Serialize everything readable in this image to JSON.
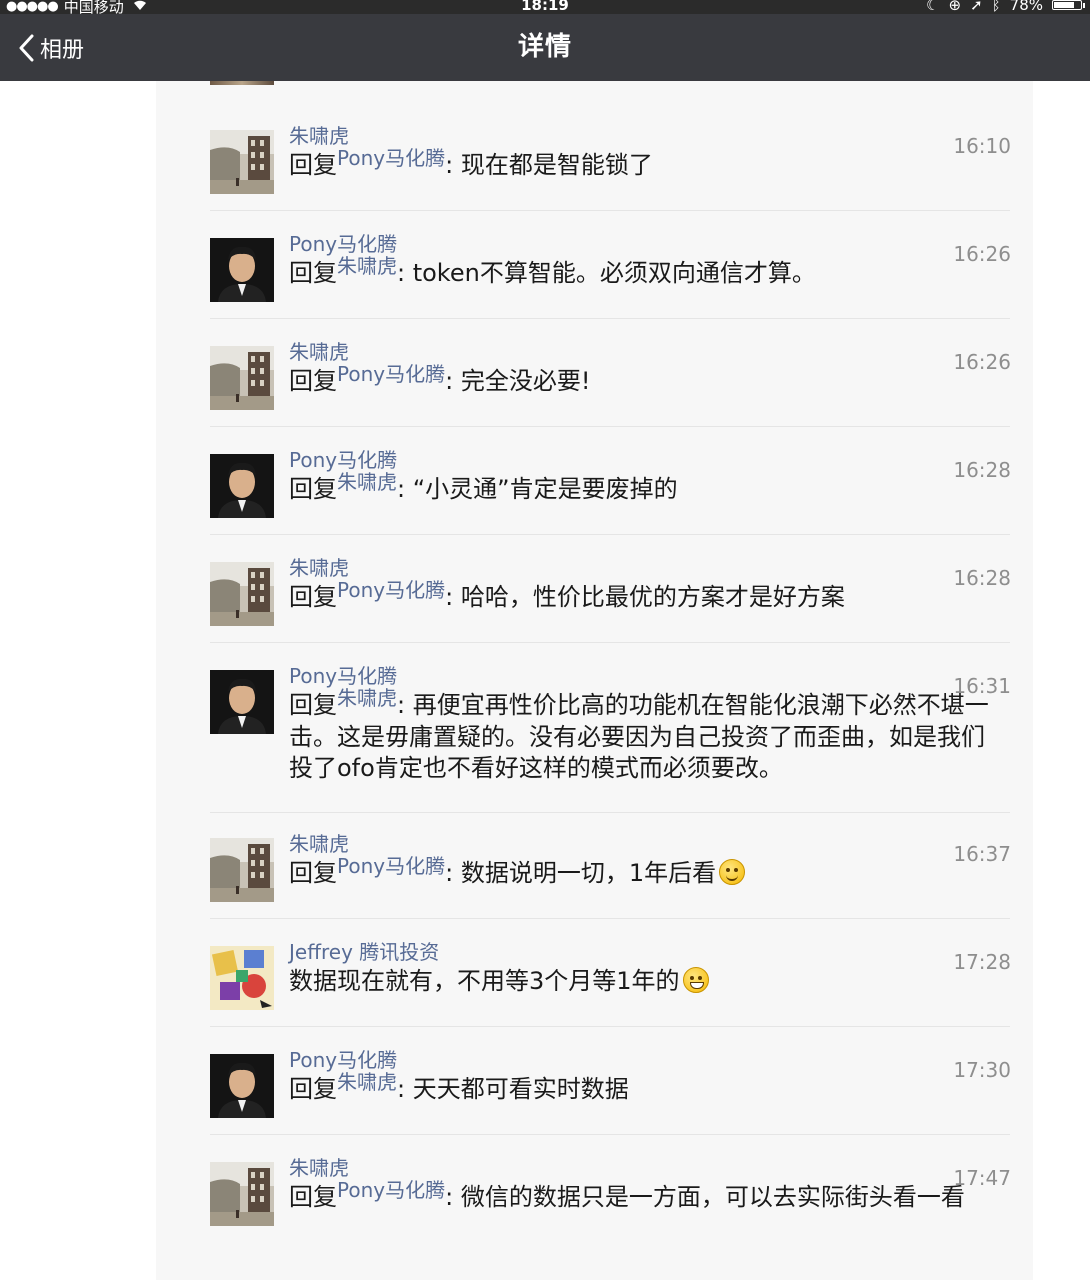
{
  "status_bar": {
    "signal": "●●●●●",
    "carrier": "中国移动",
    "wifi_icon": "wifi-icon",
    "time": "18:19",
    "battery": "78%",
    "battery_level": 0.78
  },
  "nav": {
    "back_label": "相册",
    "title": "详情"
  },
  "comments": [
    {
      "author": "朱啸虎",
      "avatar": "buildings",
      "reply_prefix": "回复",
      "reply_to": "Pony马化腾",
      "text": ": 现在都是智能锁了",
      "time": "16:10"
    },
    {
      "author": "Pony马化腾",
      "avatar": "portrait",
      "reply_prefix": "回复",
      "reply_to": "朱啸虎",
      "text": ": token不算智能。必须双向通信才算。",
      "time": "16:26"
    },
    {
      "author": "朱啸虎",
      "avatar": "buildings",
      "reply_prefix": "回复",
      "reply_to": "Pony马化腾",
      "text": ": 完全没必要!",
      "time": "16:26"
    },
    {
      "author": "Pony马化腾",
      "avatar": "portrait",
      "reply_prefix": "回复",
      "reply_to": "朱啸虎",
      "text": ": “小灵通”肯定是要废掉的",
      "time": "16:28"
    },
    {
      "author": "朱啸虎",
      "avatar": "buildings",
      "reply_prefix": "回复",
      "reply_to": "Pony马化腾",
      "text": ": 哈哈，性价比最优的方案才是好方案",
      "time": "16:28"
    },
    {
      "author": "Pony马化腾",
      "avatar": "portrait",
      "reply_prefix": "回复",
      "reply_to": "朱啸虎",
      "text": ": 再便宜再性价比高的功能机在智能化浪潮下必然不堪一击。这是毋庸置疑的。没有必要因为自己投资了而歪曲，如是我们投了ofo肯定也不看好这样的模式而必须要改。",
      "time": "16:31"
    },
    {
      "author": "朱啸虎",
      "avatar": "buildings",
      "reply_prefix": "回复",
      "reply_to": "Pony马化腾",
      "text": ": 数据说明一切，1年后看",
      "emoji": "smile-emoji",
      "time": "16:37"
    },
    {
      "author": "Jeffrey 腾讯投资",
      "avatar": "colorful",
      "reply_prefix": "",
      "reply_to": "",
      "text": "数据现在就有，不用等3个月等1年的",
      "emoji": "grin-emoji",
      "time": "17:28"
    },
    {
      "author": "Pony马化腾",
      "avatar": "portrait",
      "reply_prefix": "回复",
      "reply_to": "朱啸虎",
      "text": ": 天天都可看实时数据",
      "time": "17:30"
    },
    {
      "author": "朱啸虎",
      "avatar": "buildings",
      "reply_prefix": "回复",
      "reply_to": "Pony马化腾",
      "text": ": 微信的数据只是一方面，可以去实际街头看一看",
      "time": "17:47"
    }
  ]
}
